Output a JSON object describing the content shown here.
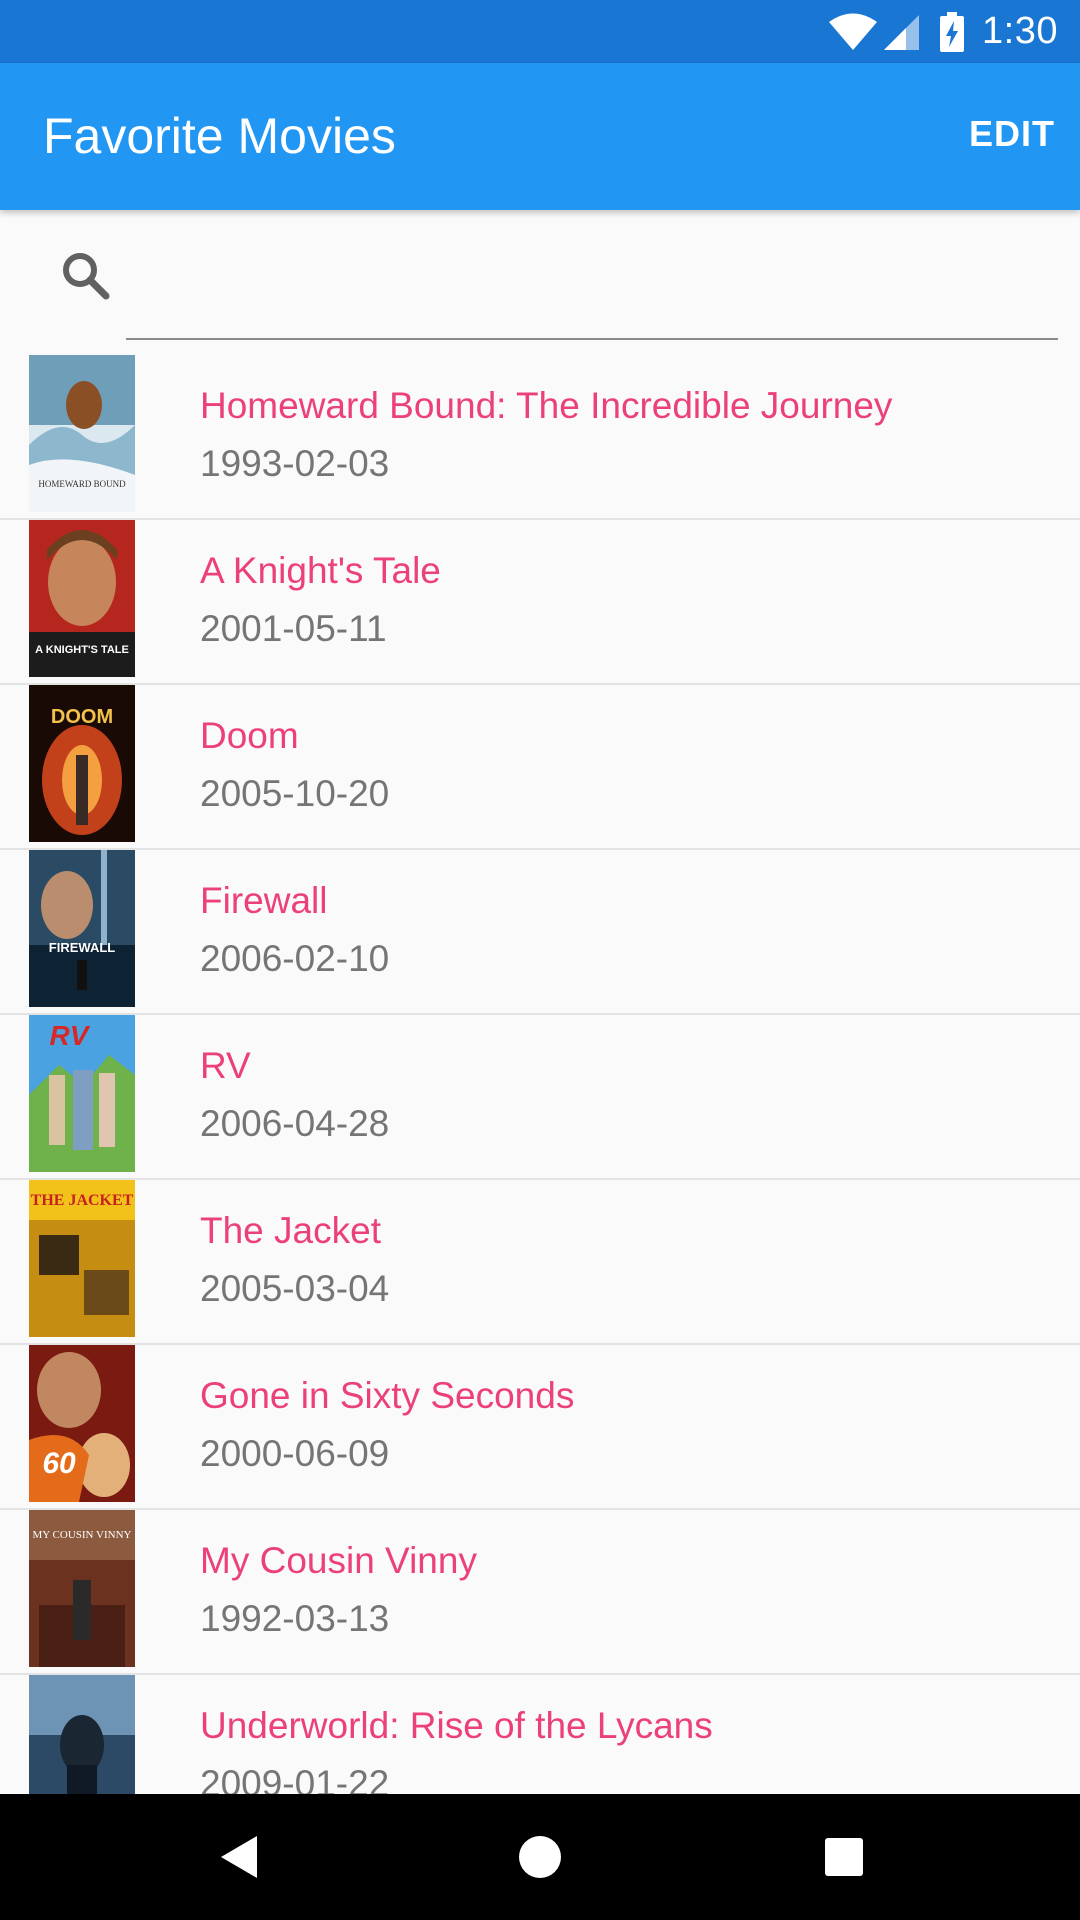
{
  "status_bar": {
    "time": "1:30",
    "wifi_icon": "wifi-icon",
    "signal_icon": "cell-signal-icon",
    "battery_icon": "battery-charging-icon"
  },
  "app_bar": {
    "title": "Favorite Movies",
    "edit_label": "EDIT",
    "color": "#2196f3",
    "status_color": "#1976d2"
  },
  "search": {
    "icon": "search-icon",
    "placeholder": "",
    "value": ""
  },
  "movies": [
    {
      "title": "Homeward Bound: The Incredible Journey",
      "date": "1993-02-03",
      "poster_text": "HOMEWARD BOUND"
    },
    {
      "title": "A Knight's Tale",
      "date": "2001-05-11",
      "poster_text": "A KNIGHT'S TALE"
    },
    {
      "title": "Doom",
      "date": "2005-10-20",
      "poster_text": "DOOM"
    },
    {
      "title": "Firewall",
      "date": "2006-02-10",
      "poster_text": "FIREWALL"
    },
    {
      "title": "RV",
      "date": "2006-04-28",
      "poster_text": "RV"
    },
    {
      "title": "The Jacket",
      "date": "2005-03-04",
      "poster_text": "THE JACKET"
    },
    {
      "title": "Gone in Sixty Seconds",
      "date": "2000-06-09",
      "poster_text": "60"
    },
    {
      "title": "My Cousin Vinny",
      "date": "1992-03-13",
      "poster_text": "MY COUSIN VINNY"
    },
    {
      "title": "Underworld: Rise of the Lycans",
      "date": "2009-01-22",
      "poster_text": ""
    }
  ],
  "colors": {
    "title_accent": "#ec407a",
    "date_text": "#757575",
    "divider": "#e3e3e3"
  },
  "nav_bar": {
    "back_icon": "back-triangle-icon",
    "home_icon": "home-circle-icon",
    "recents_icon": "recents-square-icon"
  }
}
